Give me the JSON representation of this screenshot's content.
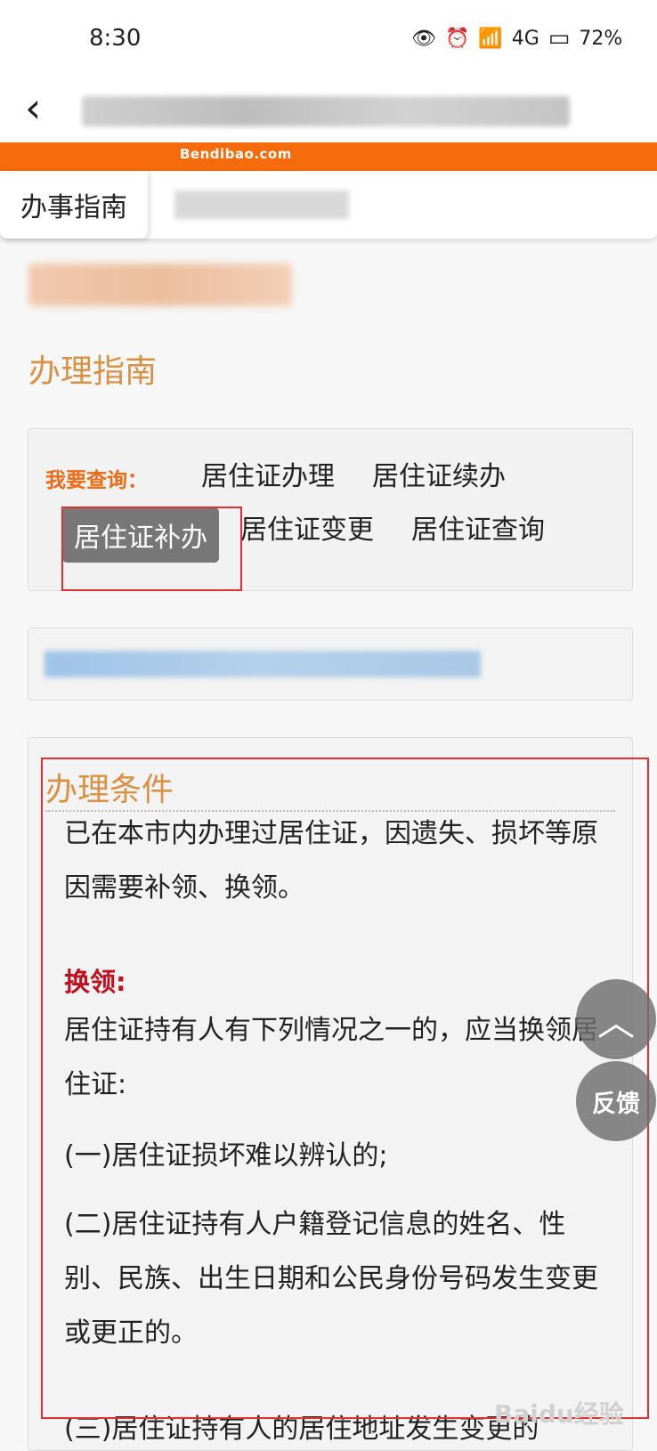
{
  "status_bar": {
    "time": "8:30",
    "battery": "72%"
  },
  "brand_bar": {
    "brand": "Bendibao.com"
  },
  "breadcrumb": {
    "tab": "办事指南"
  },
  "section": {
    "title": "办理指南"
  },
  "query": {
    "label": "我要查询：",
    "links": [
      "居住证办理",
      "居住证续办",
      "居住证补办",
      "居住证变更",
      "居住证查询"
    ],
    "active": "居住证补办"
  },
  "conditions": {
    "title": "办理条件",
    "intro": "已在本市内办理过居住证，因遗失、损坏等原因需要补领、换领。",
    "subhead": "换领:",
    "p1": "居住证持有人有下列情况之一的，应当换领居住证:",
    "p2": "(一)居住证损坏难以辨认的;",
    "p3": "(二)居住证持有人户籍登记信息的姓名、性别、民族、出生日期和公民身份号码发生变更或更正的。",
    "p4_partial": "(三)居住证持有人的居住地址发生变更的"
  },
  "floating": {
    "up_icon": "chevron-up-icon",
    "feedback": "反馈"
  },
  "watermark": "Baidu经验"
}
